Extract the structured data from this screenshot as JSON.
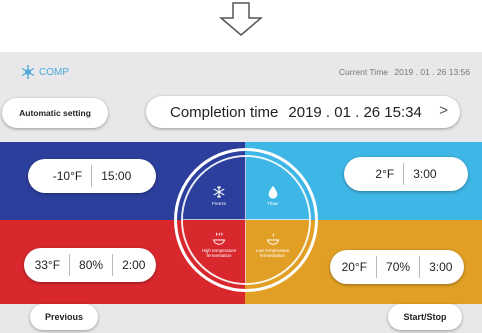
{
  "header": {
    "comp_label": "COMP",
    "current_time_label": "Current Time",
    "current_time_value": "2019 . 01 . 26  13:56"
  },
  "automatic_setting_label": "Automatic setting",
  "completion": {
    "label": "Completion time",
    "value": "2019 . 01 . 26  15:34",
    "chevron": ">"
  },
  "modes": {
    "freeze": {
      "label": "Freeze",
      "temp": "-10°F",
      "time": "15:00",
      "color": "#2c3f9d"
    },
    "thaw": {
      "label": "Thaw",
      "temp": "2°F",
      "time": "3:00",
      "color": "#3eb6e6"
    },
    "high": {
      "label": "High temperature fermentation",
      "temp": "33°F",
      "humidity": "80%",
      "time": "2:00",
      "color": "#d8282e"
    },
    "low": {
      "label": "Low temperature fermentation",
      "temp": "20°F",
      "humidity": "70%",
      "time": "3:00",
      "color": "#e1a025"
    }
  },
  "footer": {
    "previous_label": "Previous",
    "start_stop_label": "Start/Stop"
  },
  "icons": [
    "arrow-down-icon",
    "snowflake-icon",
    "droplet-icon",
    "steam-bowl-icon"
  ]
}
